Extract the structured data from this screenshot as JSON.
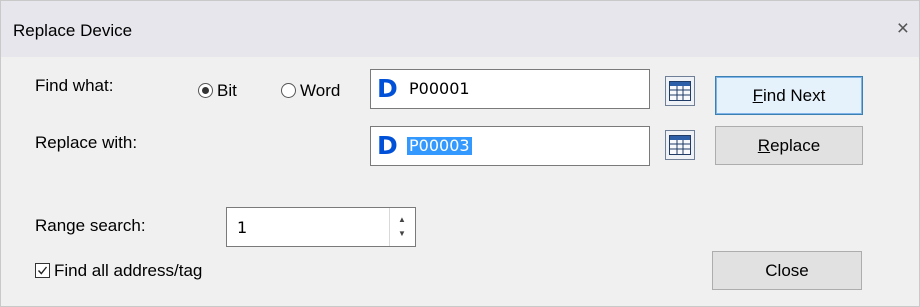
{
  "dialog": {
    "title": "Replace Device",
    "close_glyph": "×"
  },
  "find": {
    "label": "Find what:",
    "radio_bit_label": "Bit",
    "radio_word_label": "Word",
    "selected_type": "Bit",
    "device_glyph": "D",
    "value": "P00001"
  },
  "replace": {
    "label": "Replace with:",
    "device_glyph": "D",
    "value": "P00003"
  },
  "range": {
    "label": "Range search:",
    "value": "1"
  },
  "options": {
    "find_all_label": "Find all address/tag",
    "find_all_checked": true
  },
  "buttons": {
    "find_next_mnemonic": "F",
    "find_next_rest": "ind Next",
    "replace_mnemonic": "R",
    "replace_rest": "eplace",
    "close_label": "Close"
  },
  "icons": {
    "device_table": "table-grid-icon",
    "spin_up": "spin-up-icon",
    "spin_down": "spin-down-icon",
    "checkbox": "checkmark-icon"
  },
  "colors": {
    "device_glyph": "#0050d8",
    "selection": "#3399ff",
    "default_button_border": "#3c7fb1"
  }
}
